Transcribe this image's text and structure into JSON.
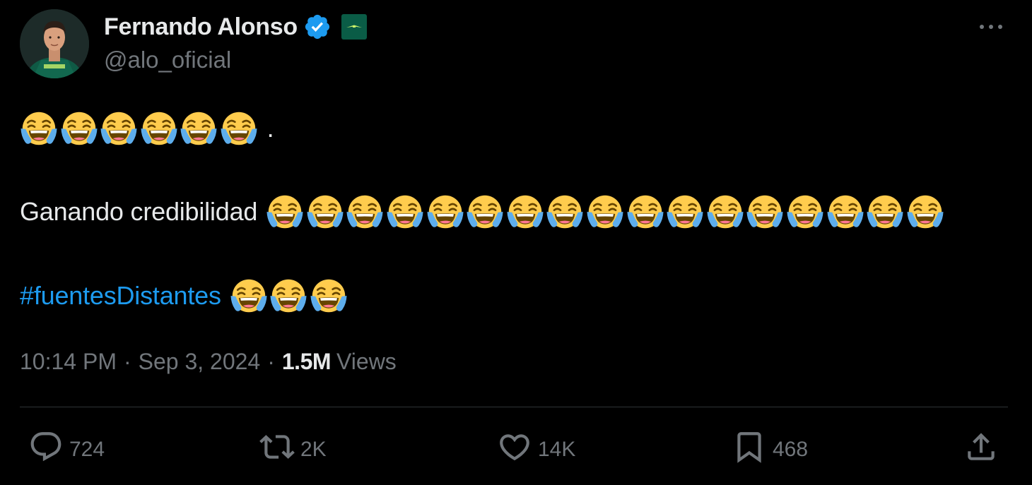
{
  "author": {
    "display_name": "Fernando Alonso",
    "handle": "@alo_oficial",
    "verified_icon": "verified-badge-icon",
    "affiliate_icon": "aston-martin-affiliate-icon"
  },
  "menu": {
    "more_icon": "more-options-icon"
  },
  "content": {
    "line1": {
      "emoji_count": 6,
      "emoji": "face-with-tears-of-joy",
      "trailing": "."
    },
    "line2": {
      "text": "Ganando credibilidad",
      "emoji_count": 17,
      "emoji": "face-with-tears-of-joy"
    },
    "line3": {
      "hashtag": "#fuentesDistantes",
      "emoji_count": 3,
      "emoji": "face-with-tears-of-joy"
    }
  },
  "meta": {
    "time": "10:14 PM",
    "separator": "·",
    "date": "Sep 3, 2024",
    "views_count": "1.5M",
    "views_label": "Views"
  },
  "actions": {
    "reply": {
      "icon": "reply-icon",
      "count": "724"
    },
    "retweet": {
      "icon": "retweet-icon",
      "count": "2K"
    },
    "like": {
      "icon": "heart-icon",
      "count": "14K"
    },
    "bookmark": {
      "icon": "bookmark-icon",
      "count": "468"
    },
    "share": {
      "icon": "share-icon"
    }
  },
  "colors": {
    "background": "#000000",
    "text_primary": "#e7e9ea",
    "text_secondary": "#71767b",
    "link": "#1d9bf0",
    "verified": "#1d9bf0",
    "affiliate": "#0a5c46",
    "divider": "#2f3336"
  }
}
